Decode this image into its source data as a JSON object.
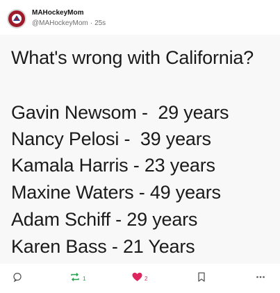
{
  "post": {
    "display_name": "MAHockeyMom",
    "handle": "@MAHockeyMom",
    "separator": "·",
    "time_ago": "25s"
  },
  "image_text": {
    "lines": [
      "What's wrong with California?",
      "Gavin Newsom -  29 years",
      "Nancy Pelosi -  39 years",
      "Kamala Harris - 23 years",
      "Maxine Waters - 49 years",
      "Adam Schiff - 29 years",
      "Karen Bass - 21 Years"
    ]
  },
  "actions": {
    "reply_icon": "reply-icon",
    "repost_icon": "repost-icon",
    "repost_count": "1",
    "like_icon": "heart-icon",
    "like_count": "2",
    "bookmark_icon": "bookmark-icon",
    "more_icon": "more-icon"
  },
  "colors": {
    "repost": "#23a04b",
    "like": "#e0245e",
    "avatar": "#9e1b2b"
  }
}
